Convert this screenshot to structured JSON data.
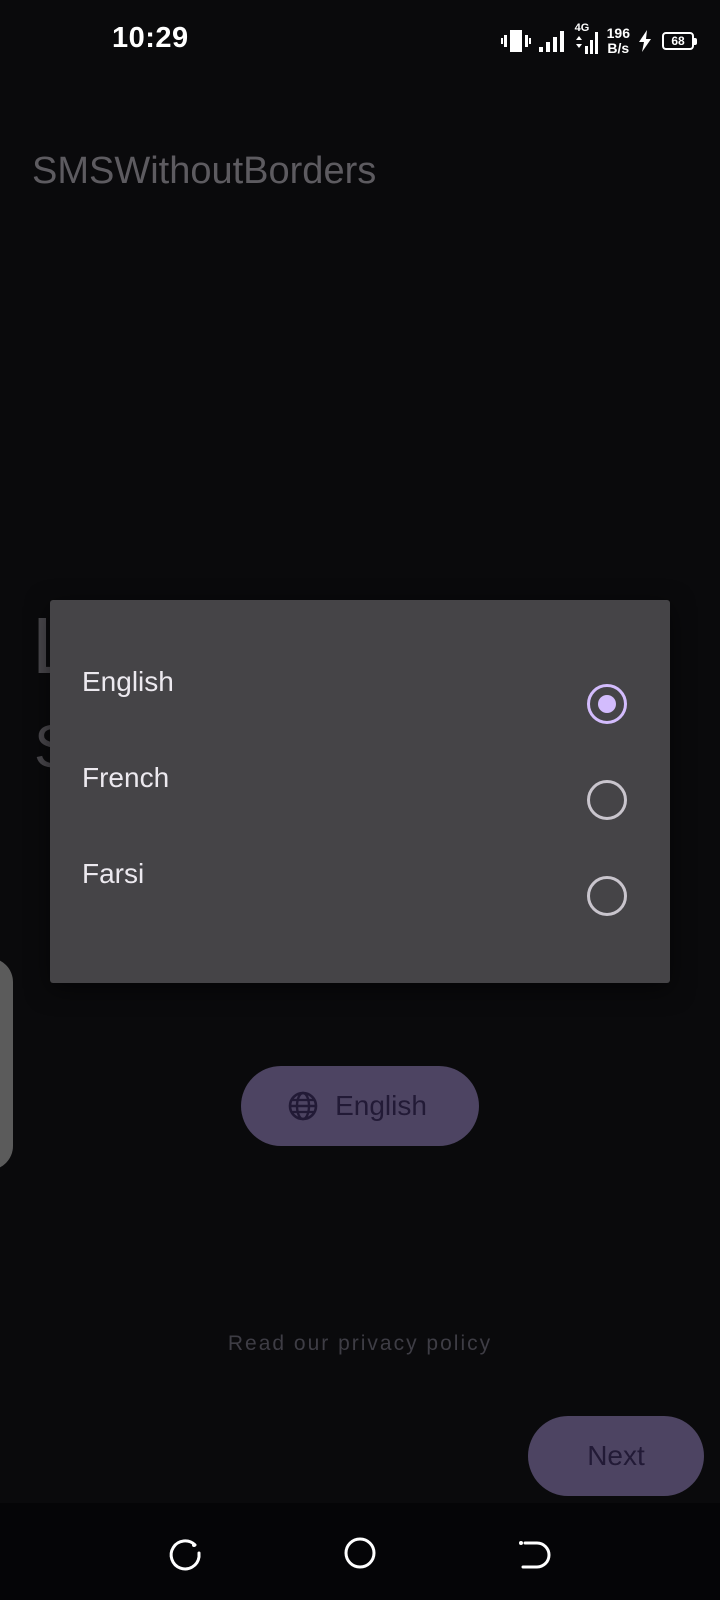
{
  "status_bar": {
    "time": "10:29",
    "network_type": "4G",
    "speed_value": "196",
    "speed_unit": "B/s",
    "battery": "68",
    "icons": [
      "vibrate-icon",
      "signal-icon",
      "signal-4g-icon",
      "charging-icon",
      "battery-icon"
    ]
  },
  "app": {
    "title": "SMSWithoutBorders"
  },
  "dialog": {
    "options": [
      {
        "label": "English",
        "selected": true
      },
      {
        "label": "French",
        "selected": false
      },
      {
        "label": "Farsi",
        "selected": false
      }
    ]
  },
  "language_button": {
    "label": "English",
    "icon": "globe-icon"
  },
  "privacy_link": "Read our privacy policy",
  "next_button": {
    "label": "Next"
  },
  "navigation_bar": {
    "icons": [
      "recents-icon",
      "home-icon",
      "back-icon"
    ]
  },
  "colors": {
    "background": "#0a0a0c",
    "dialog": "#454447",
    "accent": "#d3bcfd",
    "button": "#4d4462"
  }
}
